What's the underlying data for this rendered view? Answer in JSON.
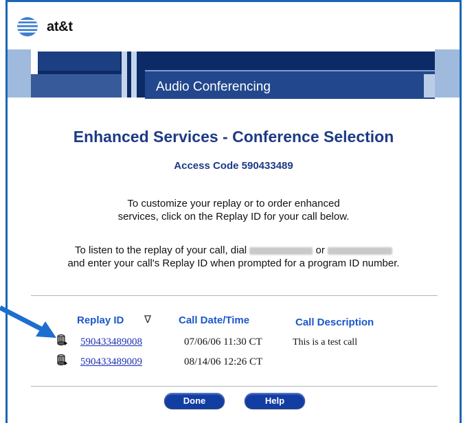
{
  "brand": {
    "logo_text": "at&t"
  },
  "banner": {
    "title": "Audio Conferencing"
  },
  "page": {
    "title": "Enhanced Services - Conference Selection",
    "access_code": "Access Code 590433489"
  },
  "instructions": {
    "para1_line1": "To customize your replay or to order enhanced",
    "para1_line2": "services, click on the Replay ID for your call below.",
    "para2_prefix": "To listen to the replay of your call, dial",
    "para2_or": "or",
    "para2_line2": "and enter your call's Replay ID when prompted for a program ID number."
  },
  "table": {
    "headers": {
      "replay_id": "Replay ID",
      "sort_glyph": "∇",
      "call_datetime": "Call Date/Time",
      "call_description": "Call Description"
    },
    "rows": [
      {
        "replay_id": "590433489008",
        "datetime": "07/06/06  11:30 CT",
        "description": "This is a test call"
      },
      {
        "replay_id": "590433489009",
        "datetime": "08/14/06  12:26 CT",
        "description": ""
      }
    ]
  },
  "buttons": {
    "done": "Done",
    "help": "Help"
  },
  "icons": {
    "row_icon": "recording-drum-icon",
    "annotation": "blue-arrow-icon",
    "sort": "sort-down-icon"
  },
  "colors": {
    "frame": "#1a66b8",
    "title": "#1d3a86",
    "link": "#1a2fb5",
    "header": "#1a57c9",
    "button": "#123da3"
  }
}
